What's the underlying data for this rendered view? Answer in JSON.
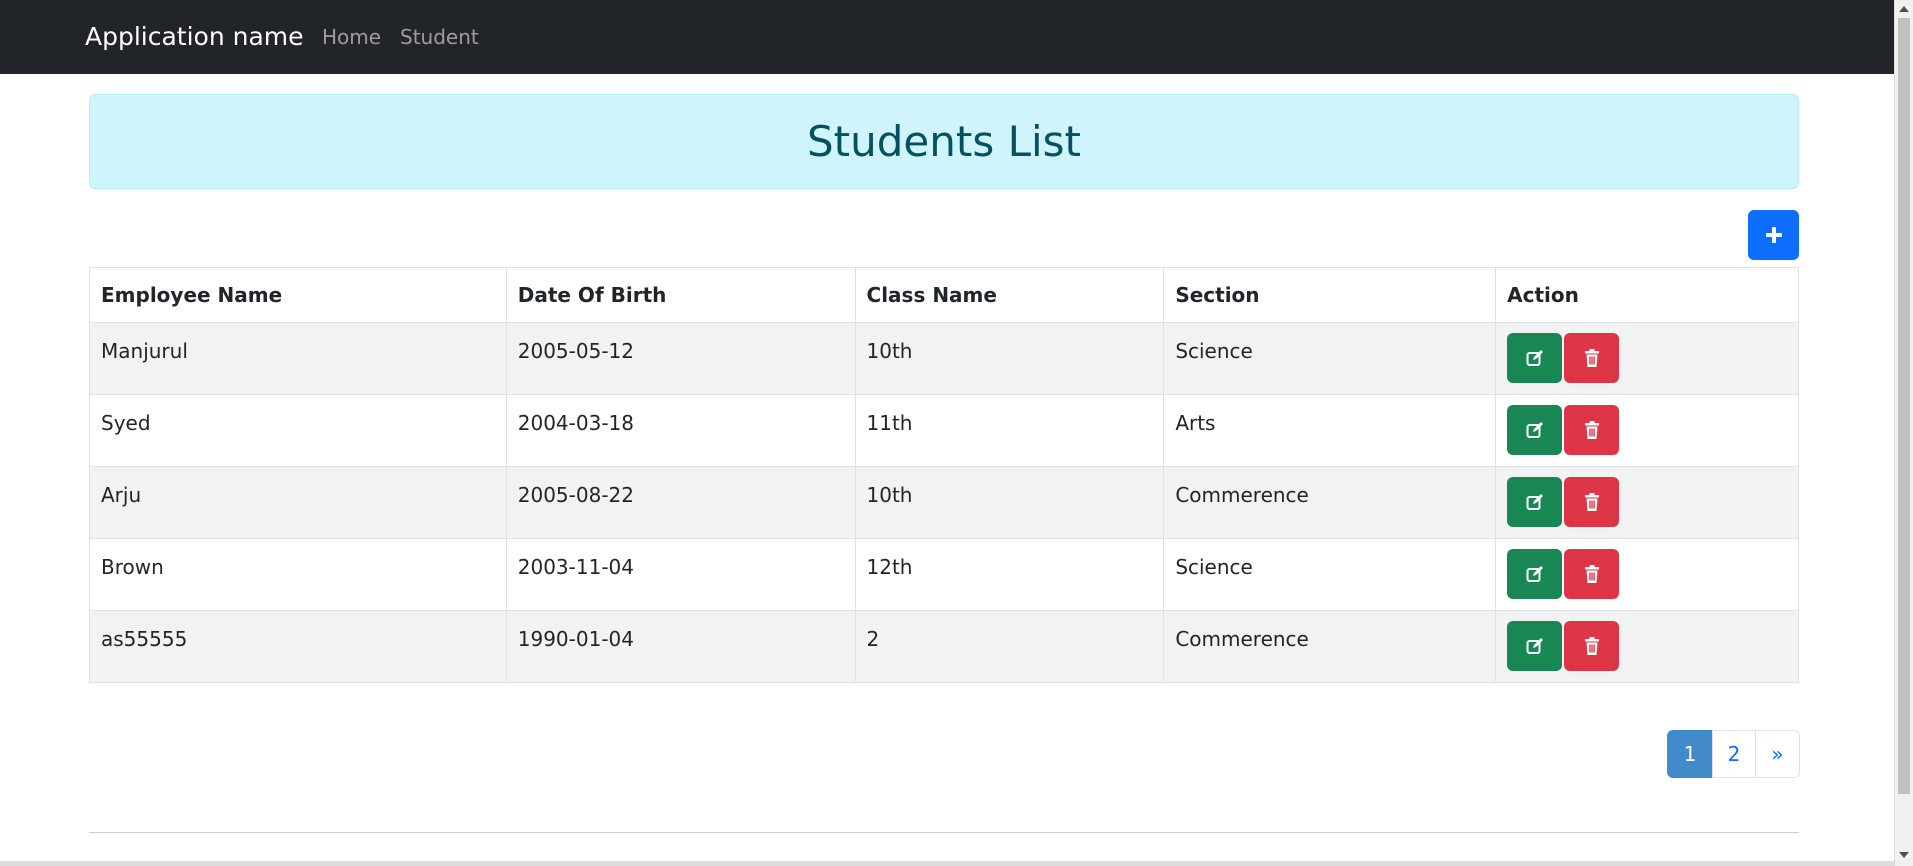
{
  "navbar": {
    "brand": "Application name",
    "links": [
      {
        "label": "Home"
      },
      {
        "label": "Student"
      }
    ]
  },
  "banner": {
    "title": "Students List"
  },
  "actions": {
    "add_icon": "plus-icon"
  },
  "table": {
    "headers": [
      "Employee Name",
      "Date Of Birth",
      "Class Name",
      "Section",
      "Action"
    ],
    "rows": [
      {
        "name": "Manjurul",
        "dob": "2005-05-12",
        "class_name": "10th",
        "section": "Science"
      },
      {
        "name": "Syed",
        "dob": "2004-03-18",
        "class_name": "11th",
        "section": "Arts"
      },
      {
        "name": "Arju",
        "dob": "2005-08-22",
        "class_name": "10th",
        "section": "Commerence"
      },
      {
        "name": "Brown",
        "dob": "2003-11-04",
        "class_name": "12th",
        "section": "Science"
      },
      {
        "name": "as55555",
        "dob": "1990-01-04",
        "class_name": "2",
        "section": "Commerence"
      }
    ],
    "row_action_icons": [
      "edit-icon",
      "trash-icon"
    ]
  },
  "pagination": {
    "pages": [
      "1",
      "2"
    ],
    "active_page": "1",
    "next_label": "»"
  },
  "colors": {
    "navbar_bg": "#212529",
    "banner_bg": "#cff4fc",
    "banner_text": "#055160",
    "primary": "#0d6efd",
    "success": "#198754",
    "danger": "#dc3545",
    "active_page": "#428bca"
  }
}
